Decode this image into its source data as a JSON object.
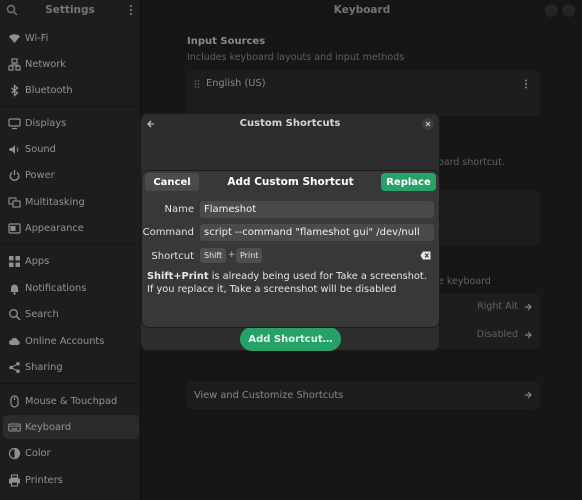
{
  "sidebar": {
    "title": "Settings",
    "items": [
      {
        "label": "Wi-Fi",
        "icon": "wifi-icon"
      },
      {
        "label": "Network",
        "icon": "network-icon"
      },
      {
        "label": "Bluetooth",
        "icon": "bluetooth-icon"
      },
      {
        "label": "Displays",
        "icon": "display-icon"
      },
      {
        "label": "Sound",
        "icon": "sound-icon"
      },
      {
        "label": "Power",
        "icon": "power-icon"
      },
      {
        "label": "Multitasking",
        "icon": "multitasking-icon"
      },
      {
        "label": "Appearance",
        "icon": "appearance-icon"
      },
      {
        "label": "Apps",
        "icon": "apps-icon"
      },
      {
        "label": "Notifications",
        "icon": "bell-icon"
      },
      {
        "label": "Search",
        "icon": "search-icon"
      },
      {
        "label": "Online Accounts",
        "icon": "cloud-icon"
      },
      {
        "label": "Sharing",
        "icon": "share-icon"
      },
      {
        "label": "Mouse & Touchpad",
        "icon": "mouse-icon"
      },
      {
        "label": "Keyboard",
        "icon": "keyboard-icon",
        "active": true
      },
      {
        "label": "Color",
        "icon": "color-icon"
      },
      {
        "label": "Printers",
        "icon": "printer-icon"
      }
    ]
  },
  "main": {
    "title": "Keyboard",
    "input_sources": {
      "title": "Input Sources",
      "subtitle": "Includes keyboard layouts and input methods",
      "source": "English (US)"
    },
    "behind_text_1": "oard shortcut.",
    "behind_text_2": "e keyboard",
    "right_alt": "Right Alt",
    "disabled": "Disabled",
    "view_shortcuts": "View and Customize Shortcuts"
  },
  "custom_shortcuts": {
    "title": "Custom Shortcuts",
    "add_button": "Add Shortcut…"
  },
  "add_dialog": {
    "cancel": "Cancel",
    "title": "Add Custom Shortcut",
    "replace": "Replace",
    "name_label": "Name",
    "name_value": "Flameshot",
    "command_label": "Command",
    "command_value": "script --command \"flameshot gui\" /dev/null",
    "shortcut_label": "Shortcut",
    "key1": "Shift",
    "plus": "+",
    "key2": "Print",
    "warning_bold": "Shift+Print",
    "warning_rest": " is already being used for Take a screenshot. If you replace it, Take a screenshot will be disabled"
  },
  "colors": {
    "accent": "#26a269",
    "window_bg": "#242424",
    "sidebar_bg": "#303030"
  }
}
